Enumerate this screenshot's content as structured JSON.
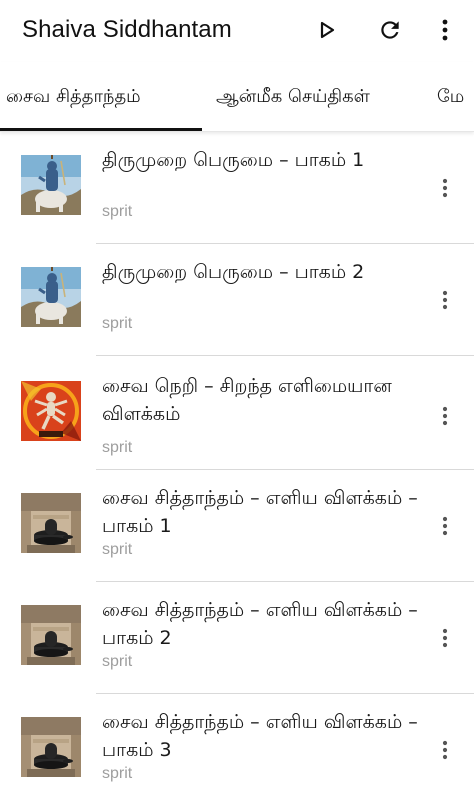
{
  "app": {
    "title": "Shaiva Siddhantam"
  },
  "toolbar": {
    "actions": [
      "play-icon",
      "refresh-icon",
      "more-vert-icon"
    ]
  },
  "tabs": [
    {
      "label": "சைவ சித்தாந்தம்",
      "selected": true
    },
    {
      "label": "ஆன்மீக செய்திகள்",
      "selected": false
    },
    {
      "label": "மே",
      "selected": false
    }
  ],
  "list": {
    "items": [
      {
        "title": "திருமுறை பெருமை – பாகம் 1",
        "subtitle": "sprit",
        "thumbnail": "shiva-image"
      },
      {
        "title": "திருமுறை பெருமை – பாகம் 2",
        "subtitle": "sprit",
        "thumbnail": "shiva-image"
      },
      {
        "title": "சைவ நெறி – சிறந்த எளிமையான விளக்கம்",
        "subtitle": "sprit",
        "thumbnail": "nataraja-image"
      },
      {
        "title": "சைவ சித்தாந்தம் – எளிய விளக்கம் – பாகம் 1",
        "subtitle": "sprit",
        "thumbnail": "lingam-image"
      },
      {
        "title": "சைவ சித்தாந்தம் – எளிய விளக்கம் – பாகம் 2",
        "subtitle": "sprit",
        "thumbnail": "lingam-image"
      },
      {
        "title": "சைவ சித்தாந்தம் – எளிய விளக்கம் – பாகம் 3",
        "subtitle": "sprit",
        "thumbnail": "lingam-image"
      }
    ]
  },
  "colors": {
    "text": "#1a1a1a",
    "subtitle": "#9e9e9e",
    "divider": "#d9d9d9",
    "indicator": "#111111"
  }
}
